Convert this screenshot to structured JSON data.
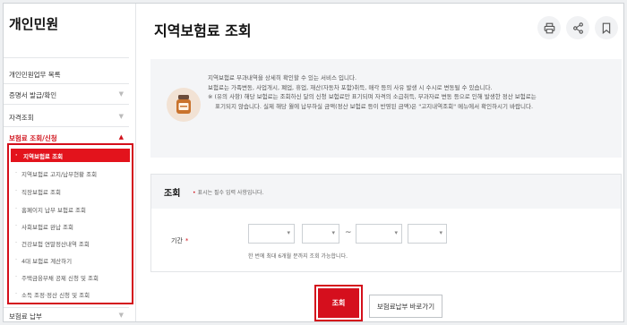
{
  "sidebar": {
    "title": "개인민원",
    "items": [
      {
        "label": "개인민원업무 목록"
      },
      {
        "label": "증명서 발급/확인",
        "chev": "▼"
      },
      {
        "label": "자격조회",
        "chev": "▼"
      },
      {
        "label": "보험료 조회/신청",
        "chev": "▲"
      },
      {
        "label": "보험료 납부",
        "chev": "▼"
      }
    ],
    "submenu": [
      "지역보험료 조회",
      "지역보험료 고지/납부현황 조회",
      "직장보험료 조회",
      "홈페이지 납부 보험료 조회",
      "사회보험료 완납 조회",
      "건강보험 연말정산내역 조회",
      "4대 보험료 계산하기",
      "주택금융부채 공제 신청 및 조회",
      "소득 조정·정산 신청 및 조회"
    ]
  },
  "header": {
    "title": "지역보험료 조회",
    "print_icon": "printer-icon",
    "share_icon": "share-icon",
    "bookmark_icon": "bookmark-icon"
  },
  "info": {
    "icon": "medicine-jar-icon",
    "lines": [
      "지역보험료 부과내역을 상세히 확인할 수 있는 서비스 입니다.",
      "보험료는 가족변동, 사업개시, 폐업, 휴업, 재산(자동차 포함)취득, 매각 등의 사유 발생 시 수시로 변동될 수 있습니다.",
      "※ (유의 사항) 해당 보험료는 조회하신 달의 신청 보험료만 표기되며 자격의 소급취득, 부과자료 변동 등으로 인해 발생한 정산 보험료는",
      "표기되지 않습니다. 실제 해당 월에 납부하실 금액(정산 보험료 등이 반영된 금액)은 \"고지내역조회\" 메뉴에서 확인하시기 바랍니다."
    ]
  },
  "query": {
    "title": "조회",
    "required_note": "표시는 필수 입력 사항입니다.",
    "period_label": "기간",
    "required_mark": "*",
    "range_separator": "~",
    "hint": "한 번에 최대 6개월 분까지 조회 가능합니다.",
    "selects": [
      "",
      "",
      "",
      ""
    ]
  },
  "actions": {
    "search_label": "조회",
    "goto_label": "보험료납부 바로가기"
  },
  "colors": {
    "accent": "#d50f1d",
    "highlight_border": "#d40f1b"
  }
}
